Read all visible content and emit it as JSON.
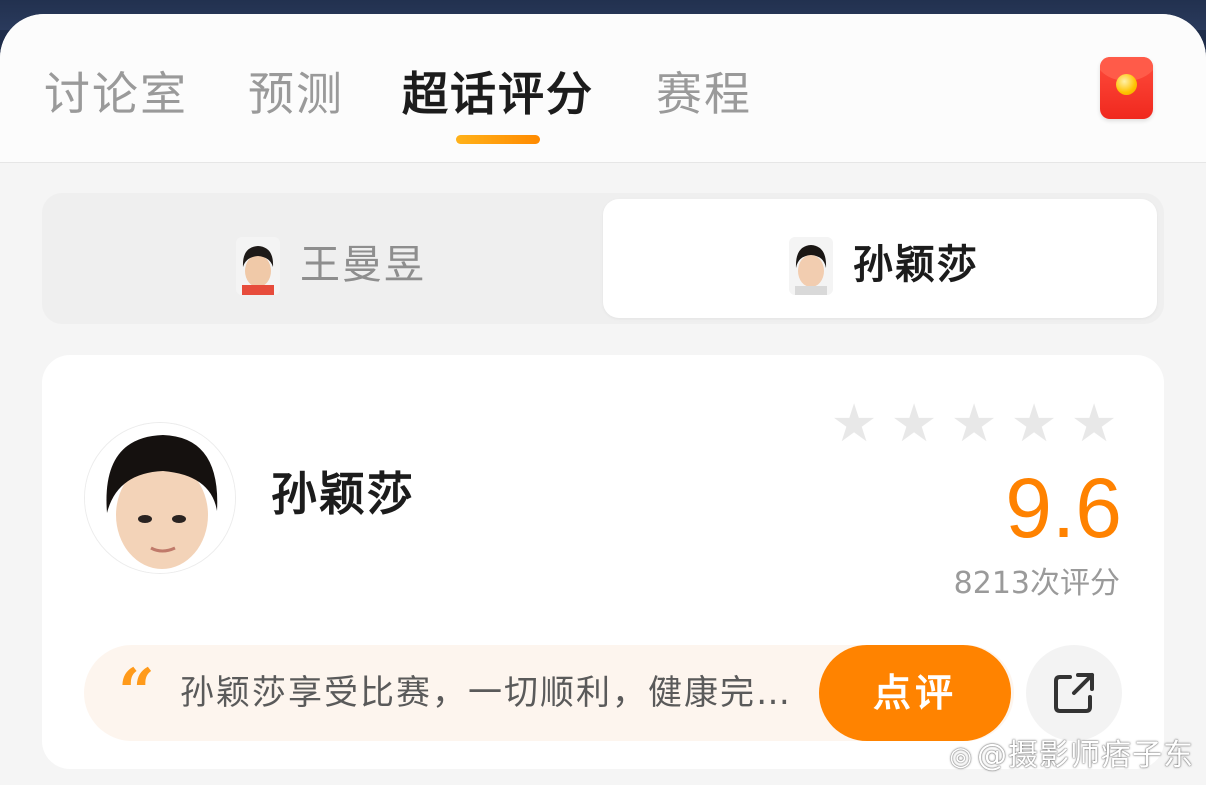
{
  "tabs": [
    {
      "label": "讨论室",
      "active": false
    },
    {
      "label": "预测",
      "active": false
    },
    {
      "label": "超话评分",
      "active": true
    },
    {
      "label": "赛程",
      "active": false
    }
  ],
  "header": {
    "red_packet_icon": "red-envelope-icon",
    "accent_color": "#ff8a00"
  },
  "player_switch": {
    "options": [
      {
        "name": "王曼昱",
        "selected": false
      },
      {
        "name": "孙颖莎",
        "selected": true
      }
    ]
  },
  "rating_card": {
    "player_name": "孙颖莎",
    "stars_total": 5,
    "score": "9.6",
    "rating_count": "8213次评分",
    "quote_text": "孙颖莎享受比赛，一切顺利，健康完...",
    "review_button_label": "点评",
    "share_icon": "share-icon",
    "score_color": "#ff8200"
  },
  "watermark": "@摄影师痞子东"
}
